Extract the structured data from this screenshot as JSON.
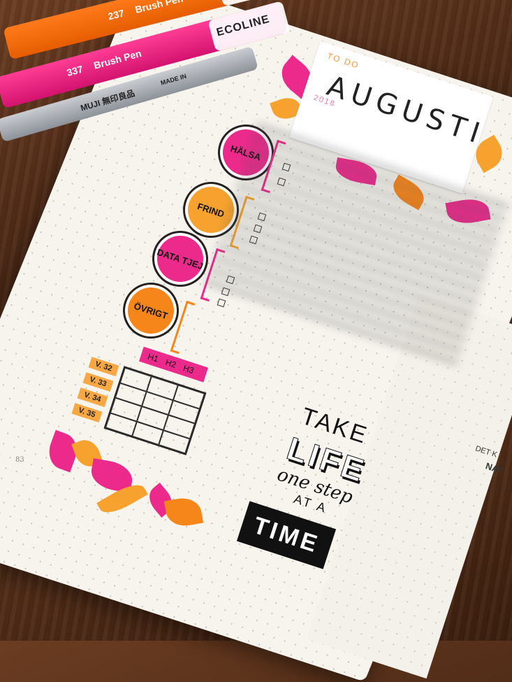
{
  "pens": {
    "orange": {
      "number": "237",
      "label": "Brush Pen",
      "color": "#ff7a1a"
    },
    "pink": {
      "number": "337",
      "label": "Brush Pen",
      "brand": "ECOLINE",
      "color": "#ec1d80"
    },
    "grey": {
      "label": "MUJI 無印良品",
      "sub": "MADE IN"
    }
  },
  "header": {
    "todo": "TO DO",
    "title": "AUGUSTI",
    "year": "2018"
  },
  "categories": [
    {
      "label": "HÄLSA",
      "color": "#ec2a8c"
    },
    {
      "label": "FRIND",
      "color": "#f7a22e"
    },
    {
      "label": "DATA TJEJ",
      "color": "#ec2a8c"
    },
    {
      "label": "ÖVRIGT",
      "color": "#f7861a"
    }
  ],
  "weeks": [
    "V. 32",
    "V. 33",
    "V. 34",
    "V. 35"
  ],
  "habit_headers": [
    "H1",
    "H2",
    "H3"
  ],
  "quote": {
    "take": "TAKE",
    "life": "LIFE",
    "one_step": "one step",
    "at_a": "AT A",
    "time": "TIME"
  },
  "page_number": "83",
  "side_text": {
    "line1": "DET K",
    "line2": "NAT"
  },
  "colors": {
    "pink": "#ec2a8c",
    "orange": "#f7a22e",
    "wood": "#4a2815"
  }
}
